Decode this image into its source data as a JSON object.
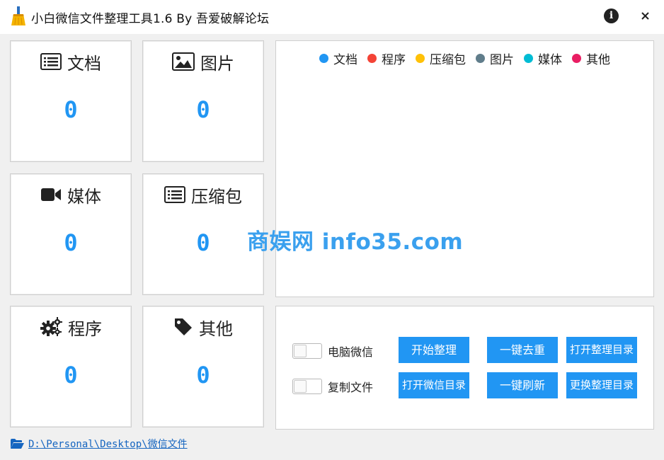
{
  "window": {
    "title": "小白微信文件整理工具1.6 By 吾爱破解论坛"
  },
  "colors": {
    "accent": "#2196f3"
  },
  "cards": [
    {
      "label": "文档",
      "count": "0",
      "icon": "document-list-icon"
    },
    {
      "label": "图片",
      "count": "0",
      "icon": "image-icon"
    },
    {
      "label": "媒体",
      "count": "0",
      "icon": "video-camera-icon"
    },
    {
      "label": "压缩包",
      "count": "0",
      "icon": "archive-list-icon"
    },
    {
      "label": "程序",
      "count": "0",
      "icon": "gears-icon"
    },
    {
      "label": "其他",
      "count": "0",
      "icon": "tag-icon"
    }
  ],
  "chart": {
    "legend": [
      {
        "label": "文档",
        "color": "#2196f3"
      },
      {
        "label": "程序",
        "color": "#f44336"
      },
      {
        "label": "压缩包",
        "color": "#ffc107"
      },
      {
        "label": "图片",
        "color": "#607d8b"
      },
      {
        "label": "媒体",
        "color": "#00bcd4"
      },
      {
        "label": "其他",
        "color": "#e91e63"
      }
    ]
  },
  "watermark": "商娱网 info35.com",
  "options": [
    {
      "label": "电脑微信",
      "checked": false
    },
    {
      "label": "复制文件",
      "checked": false
    }
  ],
  "buttons": {
    "start": "开始整理",
    "dedupe": "一键去重",
    "open_output": "打开整理目录",
    "open_wechat": "打开微信目录",
    "refresh": "一键刷新",
    "change_output": "更换整理目录"
  },
  "footer": {
    "path": "D:\\Personal\\Desktop\\微信文件"
  }
}
